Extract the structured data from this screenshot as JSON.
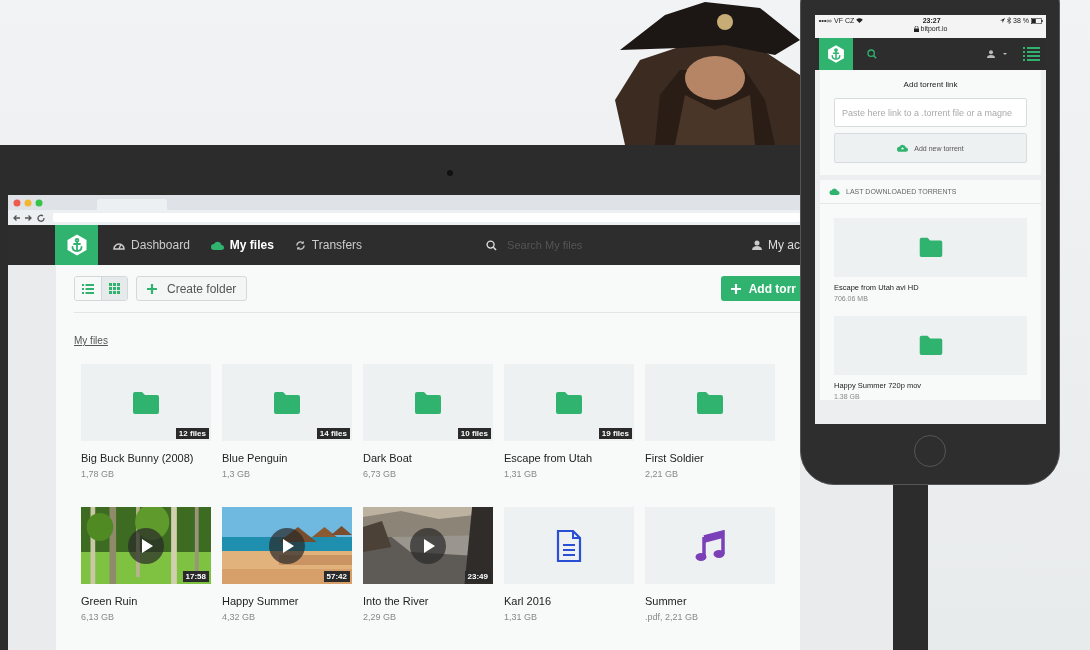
{
  "laptop": {
    "nav": {
      "items": [
        {
          "label": "Dashboard",
          "selected": false
        },
        {
          "label": "My files",
          "selected": true
        },
        {
          "label": "Transfers",
          "selected": false
        }
      ],
      "search": {
        "placeholder": "Search My files"
      },
      "account": "My ac"
    },
    "toolbar": {
      "views": [
        {
          "selected": false
        },
        {
          "selected": true
        }
      ],
      "create_folder": "Create folder",
      "add_torrent": "Add torr"
    },
    "breadcrumb": "My files",
    "files": [
      {
        "kind": "folder",
        "name": "Big Buck Bunny (2008)",
        "size": "1,78 GB",
        "badge": "12 files"
      },
      {
        "kind": "folder",
        "name": "Blue Penguin",
        "size": "1,3 GB",
        "badge": "14 files"
      },
      {
        "kind": "folder",
        "name": "Dark Boat",
        "size": "6,73 GB",
        "badge": "10 files"
      },
      {
        "kind": "folder",
        "name": "Escape from Utah",
        "size": "1,31 GB",
        "badge": "19 files"
      },
      {
        "kind": "folder",
        "name": "First Soldier",
        "size": "2,21 GB"
      },
      {
        "kind": "video",
        "name": "Green Ruin",
        "size": "6,13 GB",
        "badge": "17:58"
      },
      {
        "kind": "video",
        "name": "Happy Summer",
        "size": "4,32 GB",
        "badge": "57:42"
      },
      {
        "kind": "video",
        "name": "Into the River",
        "size": "2,29 GB",
        "badge": "23:49"
      },
      {
        "kind": "document",
        "name": "Karl 2016",
        "size": "1,31 GB"
      },
      {
        "kind": "audio",
        "name": "Summer",
        "size": ".pdf, 2,21 GB"
      }
    ]
  },
  "phone": {
    "status": {
      "carrier": "VF CZ",
      "time": "23:27",
      "battery": "38 %",
      "url": "bitport.io"
    },
    "add_link": {
      "title": "Add torrent link",
      "placeholder": "Paste here link to a .torrent file or a magne",
      "button": "Add new torrent"
    },
    "last": {
      "title": "LAST DOWNLOADED TORRENTS",
      "items": [
        {
          "name": "Escape from Utah avi HD",
          "size": "706.06 MB"
        },
        {
          "name": "Happy Summer 720p mov",
          "size": "1.38 GB"
        }
      ]
    }
  }
}
